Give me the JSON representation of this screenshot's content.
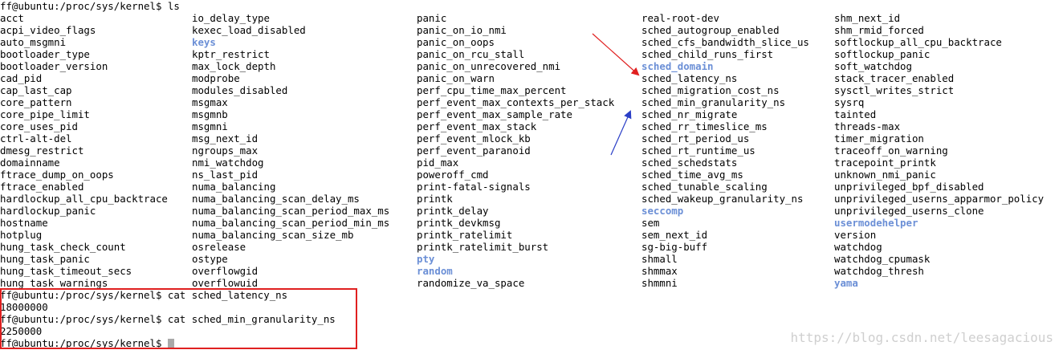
{
  "terminal": {
    "prompt_ls": "ff@ubuntu:/proc/sys/kernel$ ls",
    "columns": [
      [
        {
          "name": "acct",
          "dir": false
        },
        {
          "name": "acpi_video_flags",
          "dir": false
        },
        {
          "name": "auto_msgmni",
          "dir": false
        },
        {
          "name": "bootloader_type",
          "dir": false
        },
        {
          "name": "bootloader_version",
          "dir": false
        },
        {
          "name": "cad_pid",
          "dir": false
        },
        {
          "name": "cap_last_cap",
          "dir": false
        },
        {
          "name": "core_pattern",
          "dir": false
        },
        {
          "name": "core_pipe_limit",
          "dir": false
        },
        {
          "name": "core_uses_pid",
          "dir": false
        },
        {
          "name": "ctrl-alt-del",
          "dir": false
        },
        {
          "name": "dmesg_restrict",
          "dir": false
        },
        {
          "name": "domainname",
          "dir": false
        },
        {
          "name": "ftrace_dump_on_oops",
          "dir": false
        },
        {
          "name": "ftrace_enabled",
          "dir": false
        },
        {
          "name": "hardlockup_all_cpu_backtrace",
          "dir": false
        },
        {
          "name": "hardlockup_panic",
          "dir": false
        },
        {
          "name": "hostname",
          "dir": false
        },
        {
          "name": "hotplug",
          "dir": false
        },
        {
          "name": "hung_task_check_count",
          "dir": false
        },
        {
          "name": "hung_task_panic",
          "dir": false
        },
        {
          "name": "hung_task_timeout_secs",
          "dir": false
        },
        {
          "name": "hung_task_warnings",
          "dir": false
        }
      ],
      [
        {
          "name": "io_delay_type",
          "dir": false
        },
        {
          "name": "kexec_load_disabled",
          "dir": false
        },
        {
          "name": "keys",
          "dir": true
        },
        {
          "name": "kptr_restrict",
          "dir": false
        },
        {
          "name": "max_lock_depth",
          "dir": false
        },
        {
          "name": "modprobe",
          "dir": false
        },
        {
          "name": "modules_disabled",
          "dir": false
        },
        {
          "name": "msgmax",
          "dir": false
        },
        {
          "name": "msgmnb",
          "dir": false
        },
        {
          "name": "msgmni",
          "dir": false
        },
        {
          "name": "msg_next_id",
          "dir": false
        },
        {
          "name": "ngroups_max",
          "dir": false
        },
        {
          "name": "nmi_watchdog",
          "dir": false
        },
        {
          "name": "ns_last_pid",
          "dir": false
        },
        {
          "name": "numa_balancing",
          "dir": false
        },
        {
          "name": "numa_balancing_scan_delay_ms",
          "dir": false
        },
        {
          "name": "numa_balancing_scan_period_max_ms",
          "dir": false
        },
        {
          "name": "numa_balancing_scan_period_min_ms",
          "dir": false
        },
        {
          "name": "numa_balancing_scan_size_mb",
          "dir": false
        },
        {
          "name": "osrelease",
          "dir": false
        },
        {
          "name": "ostype",
          "dir": false
        },
        {
          "name": "overflowgid",
          "dir": false
        },
        {
          "name": "overflowuid",
          "dir": false
        }
      ],
      [
        {
          "name": "panic",
          "dir": false
        },
        {
          "name": "panic_on_io_nmi",
          "dir": false
        },
        {
          "name": "panic_on_oops",
          "dir": false
        },
        {
          "name": "panic_on_rcu_stall",
          "dir": false
        },
        {
          "name": "panic_on_unrecovered_nmi",
          "dir": false
        },
        {
          "name": "panic_on_warn",
          "dir": false
        },
        {
          "name": "perf_cpu_time_max_percent",
          "dir": false
        },
        {
          "name": "perf_event_max_contexts_per_stack",
          "dir": false
        },
        {
          "name": "perf_event_max_sample_rate",
          "dir": false
        },
        {
          "name": "perf_event_max_stack",
          "dir": false
        },
        {
          "name": "perf_event_mlock_kb",
          "dir": false
        },
        {
          "name": "perf_event_paranoid",
          "dir": false
        },
        {
          "name": "pid_max",
          "dir": false
        },
        {
          "name": "poweroff_cmd",
          "dir": false
        },
        {
          "name": "print-fatal-signals",
          "dir": false
        },
        {
          "name": "printk",
          "dir": false
        },
        {
          "name": "printk_delay",
          "dir": false
        },
        {
          "name": "printk_devkmsg",
          "dir": false
        },
        {
          "name": "printk_ratelimit",
          "dir": false
        },
        {
          "name": "printk_ratelimit_burst",
          "dir": false
        },
        {
          "name": "pty",
          "dir": true
        },
        {
          "name": "random",
          "dir": true
        },
        {
          "name": "randomize_va_space",
          "dir": false
        }
      ],
      [
        {
          "name": "real-root-dev",
          "dir": false
        },
        {
          "name": "sched_autogroup_enabled",
          "dir": false
        },
        {
          "name": "sched_cfs_bandwidth_slice_us",
          "dir": false
        },
        {
          "name": "sched_child_runs_first",
          "dir": false
        },
        {
          "name": "sched_domain",
          "dir": true
        },
        {
          "name": "sched_latency_ns",
          "dir": false
        },
        {
          "name": "sched_migration_cost_ns",
          "dir": false
        },
        {
          "name": "sched_min_granularity_ns",
          "dir": false
        },
        {
          "name": "sched_nr_migrate",
          "dir": false
        },
        {
          "name": "sched_rr_timeslice_ms",
          "dir": false
        },
        {
          "name": "sched_rt_period_us",
          "dir": false
        },
        {
          "name": "sched_rt_runtime_us",
          "dir": false
        },
        {
          "name": "sched_schedstats",
          "dir": false
        },
        {
          "name": "sched_time_avg_ms",
          "dir": false
        },
        {
          "name": "sched_tunable_scaling",
          "dir": false
        },
        {
          "name": "sched_wakeup_granularity_ns",
          "dir": false
        },
        {
          "name": "seccomp",
          "dir": true
        },
        {
          "name": "sem",
          "dir": false
        },
        {
          "name": "sem_next_id",
          "dir": false
        },
        {
          "name": "sg-big-buff",
          "dir": false
        },
        {
          "name": "shmall",
          "dir": false
        },
        {
          "name": "shmmax",
          "dir": false
        },
        {
          "name": "shmmni",
          "dir": false
        }
      ],
      [
        {
          "name": "shm_next_id",
          "dir": false
        },
        {
          "name": "shm_rmid_forced",
          "dir": false
        },
        {
          "name": "softlockup_all_cpu_backtrace",
          "dir": false
        },
        {
          "name": "softlockup_panic",
          "dir": false
        },
        {
          "name": "soft_watchdog",
          "dir": false
        },
        {
          "name": "stack_tracer_enabled",
          "dir": false
        },
        {
          "name": "sysctl_writes_strict",
          "dir": false
        },
        {
          "name": "sysrq",
          "dir": false
        },
        {
          "name": "tainted",
          "dir": false
        },
        {
          "name": "threads-max",
          "dir": false
        },
        {
          "name": "timer_migration",
          "dir": false
        },
        {
          "name": "traceoff_on_warning",
          "dir": false
        },
        {
          "name": "tracepoint_printk",
          "dir": false
        },
        {
          "name": "unknown_nmi_panic",
          "dir": false
        },
        {
          "name": "unprivileged_bpf_disabled",
          "dir": false
        },
        {
          "name": "unprivileged_userns_apparmor_policy",
          "dir": false
        },
        {
          "name": "unprivileged_userns_clone",
          "dir": false
        },
        {
          "name": "usermodehelper",
          "dir": true
        },
        {
          "name": "version",
          "dir": false
        },
        {
          "name": "watchdog",
          "dir": false
        },
        {
          "name": "watchdog_cpumask",
          "dir": false
        },
        {
          "name": "watchdog_thresh",
          "dir": false
        },
        {
          "name": "yama",
          "dir": true
        }
      ]
    ],
    "cat_latency_cmd": "ff@ubuntu:/proc/sys/kernel$ cat sched_latency_ns",
    "cat_latency_out": "18000000",
    "cat_gran_cmd": "ff@ubuntu:/proc/sys/kernel$ cat sched_min_granularity_ns",
    "cat_gran_out": "2250000",
    "final_prompt": "ff@ubuntu:/proc/sys/kernel$ "
  },
  "watermark": "https://blog.csdn.net/leesagacious",
  "colors": {
    "directory": "#6b8fd6",
    "highlight_box": "#e02020",
    "arrow_red": "#e02020",
    "arrow_blue": "#2b3fc7"
  }
}
